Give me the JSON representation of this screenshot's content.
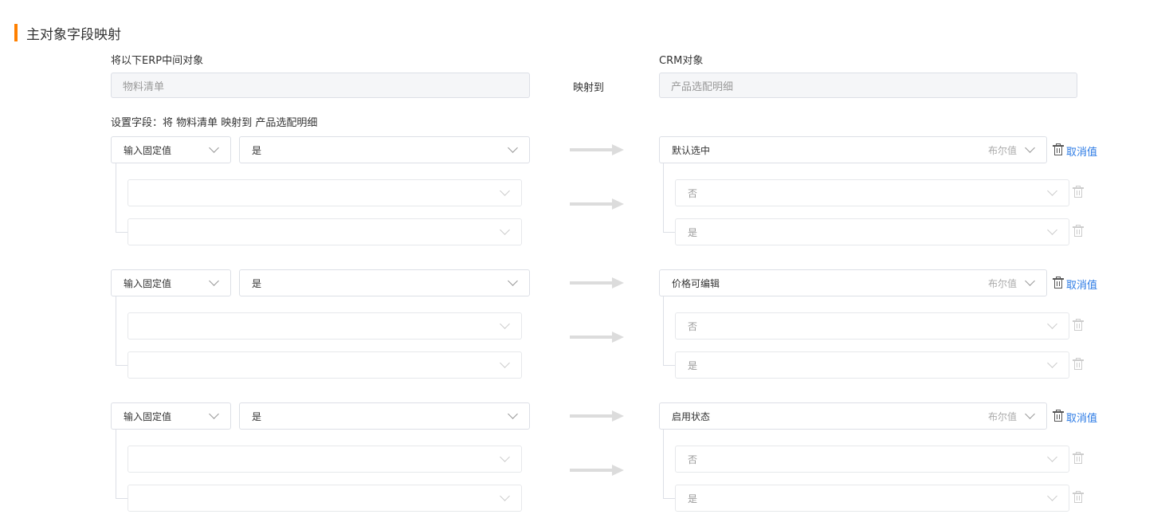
{
  "section_title": "主对象字段映射",
  "source_label": "将以下ERP中间对象",
  "source_object": "物料清单",
  "map_to_label": "映射到",
  "target_label": "CRM对象",
  "target_object": "产品选配明细",
  "settings_hint": "设置字段：将 物料清单 映射到 产品选配明细",
  "mappings": [
    {
      "source_type": "输入固定值",
      "source_value": "是",
      "target_field": "默认选中",
      "field_type": "布尔值",
      "cancel_label": "取消值",
      "options": [
        "否",
        "是"
      ]
    },
    {
      "source_type": "输入固定值",
      "source_value": "是",
      "target_field": "价格可编辑",
      "field_type": "布尔值",
      "cancel_label": "取消值",
      "options": [
        "否",
        "是"
      ]
    },
    {
      "source_type": "输入固定值",
      "source_value": "是",
      "target_field": "启用状态",
      "field_type": "布尔值",
      "cancel_label": "取消值",
      "options": [
        "否",
        "是"
      ]
    }
  ]
}
